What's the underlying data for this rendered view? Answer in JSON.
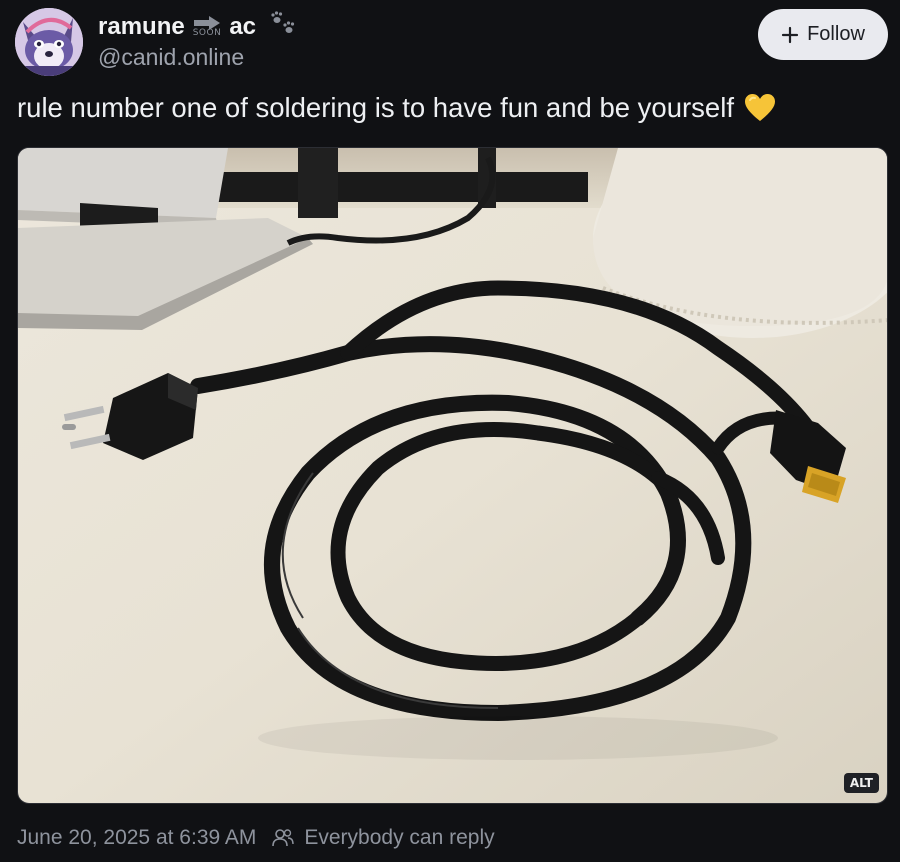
{
  "author": {
    "name_left": "ramune",
    "name_arrow_label": "SOON",
    "name_right": "ac",
    "handle": "@canid.online",
    "avatar_icon": "wolf-avatar",
    "decoration_icon": "paw-prints-icon"
  },
  "actions": {
    "follow_label": "Follow",
    "follow_icon": "plus-icon"
  },
  "post": {
    "text": "rule number one of soldering is to have fun and be yourself",
    "emoji": "yellow-heart-icon"
  },
  "media": {
    "description": "photo",
    "alt_badge": "ALT"
  },
  "footer": {
    "timestamp": "June 20, 2025 at 6:39 AM",
    "reply_setting": "Everybody can reply",
    "reply_icon": "people-icon"
  },
  "colors": {
    "background": "#101114",
    "follow_bg": "#e9eaef",
    "muted_text": "#8e939d",
    "primary_text": "#eef0f3"
  }
}
